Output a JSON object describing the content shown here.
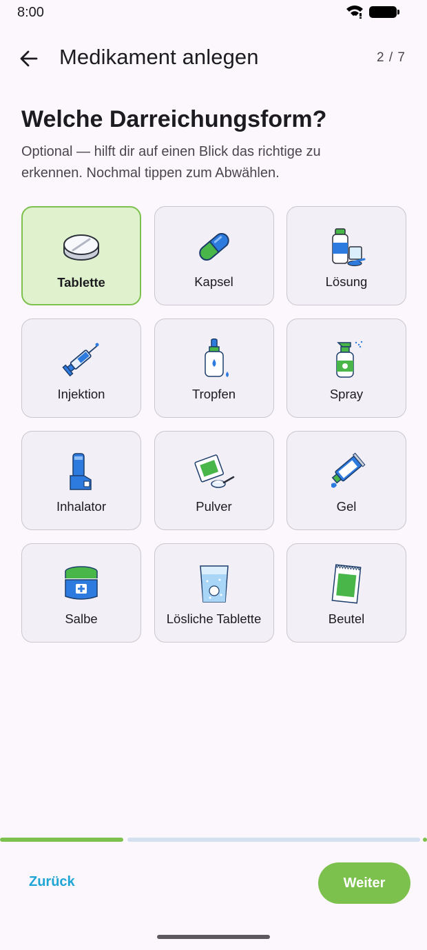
{
  "status_bar": {
    "time": "8:00"
  },
  "app_bar": {
    "title": "Medikament anlegen",
    "step": "2 / 7"
  },
  "main": {
    "question": "Welche Darreichungsform?",
    "subtitle": "Optional — hilft dir auf einen Blick das richtige zu erkennen. Nochmal tippen zum Abwählen.",
    "forms": [
      {
        "label": "Tablette",
        "icon": "tablet-icon",
        "selected": true
      },
      {
        "label": "Kapsel",
        "icon": "capsule-icon",
        "selected": false
      },
      {
        "label": "Lösung",
        "icon": "solution-icon",
        "selected": false
      },
      {
        "label": "Injektion",
        "icon": "syringe-icon",
        "selected": false
      },
      {
        "label": "Tropfen",
        "icon": "dropper-bottle-icon",
        "selected": false
      },
      {
        "label": "Spray",
        "icon": "spray-bottle-icon",
        "selected": false
      },
      {
        "label": "Inhalator",
        "icon": "inhaler-icon",
        "selected": false
      },
      {
        "label": "Pulver",
        "icon": "powder-icon",
        "selected": false
      },
      {
        "label": "Gel",
        "icon": "gel-tube-icon",
        "selected": false
      },
      {
        "label": "Salbe",
        "icon": "ointment-jar-icon",
        "selected": false
      },
      {
        "label": "Lösliche Tablette",
        "icon": "effervescent-glass-icon",
        "selected": false
      },
      {
        "label": "Beutel",
        "icon": "sachet-icon",
        "selected": false
      }
    ]
  },
  "progress": {
    "current_step": 2,
    "total_steps": 7
  },
  "footer": {
    "back_label": "Zurück",
    "next_label": "Weiter"
  },
  "colors": {
    "accent": "#7cc04e",
    "link": "#1fa5d5",
    "selected_bg": "#dff2cd",
    "background": "#fcf7fc"
  }
}
